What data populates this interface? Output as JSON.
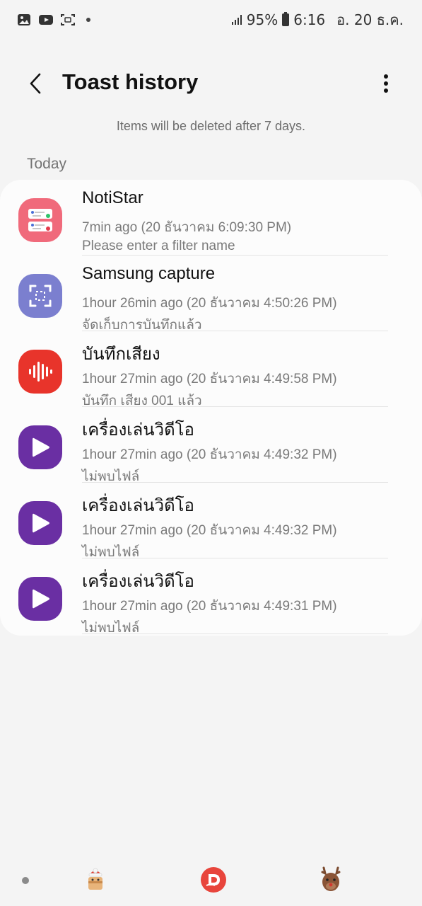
{
  "status_bar": {
    "battery": "95%",
    "time": "6:16",
    "date": "อ. 20 ธ.ค.",
    "icons": [
      "gallery-icon",
      "youtube-icon",
      "screen-capture-icon",
      "notification-dot-icon",
      "signal-icon",
      "battery-icon"
    ]
  },
  "header": {
    "title": "Toast history",
    "back_icon": "chevron-left-icon",
    "more_icon": "more-vertical-icon"
  },
  "info_note": "Items will be deleted after 7 days.",
  "section": {
    "label": "Today"
  },
  "items": [
    {
      "app": "NotiStar",
      "time": "7min ago (20 ธันวาคม 6:09:30 PM)",
      "message": "Please enter a filter name",
      "icon": "notistar-icon",
      "color": "#f06a7b"
    },
    {
      "app": "Samsung capture",
      "time": "1hour 26min ago (20 ธันวาคม 4:50:26 PM)",
      "message": "จัดเก็บการบันทึกแล้ว",
      "icon": "samsung-capture-icon",
      "color": "#7b7fcf"
    },
    {
      "app": "บันทึกเสียง",
      "time": "1hour 27min ago (20 ธันวาคม 4:49:58 PM)",
      "message": "บันทึก เสียง 001 แล้ว",
      "icon": "voice-recorder-icon",
      "color": "#e8342b"
    },
    {
      "app": "เครื่องเล่นวิดีโอ",
      "time": "1hour 27min ago (20 ธันวาคม 4:49:32 PM)",
      "message": "ไม่พบไฟล์",
      "icon": "video-player-icon",
      "color": "#6a2fa3"
    },
    {
      "app": "เครื่องเล่นวิดีโอ",
      "time": "1hour 27min ago (20 ธันวาคม 4:49:32 PM)",
      "message": "ไม่พบไฟล์",
      "icon": "video-player-icon",
      "color": "#6a2fa3"
    },
    {
      "app": "เครื่องเล่นวิดีโอ",
      "time": "1hour 27min ago (20 ธันวาคม 4:49:31 PM)",
      "message": "ไม่พบไฟล์",
      "icon": "video-player-icon",
      "color": "#6a2fa3"
    }
  ],
  "nav_bar": {
    "icons": [
      "recents-dot-icon",
      "home-gift-icon",
      "assistant-d-icon",
      "reindeer-icon"
    ]
  }
}
